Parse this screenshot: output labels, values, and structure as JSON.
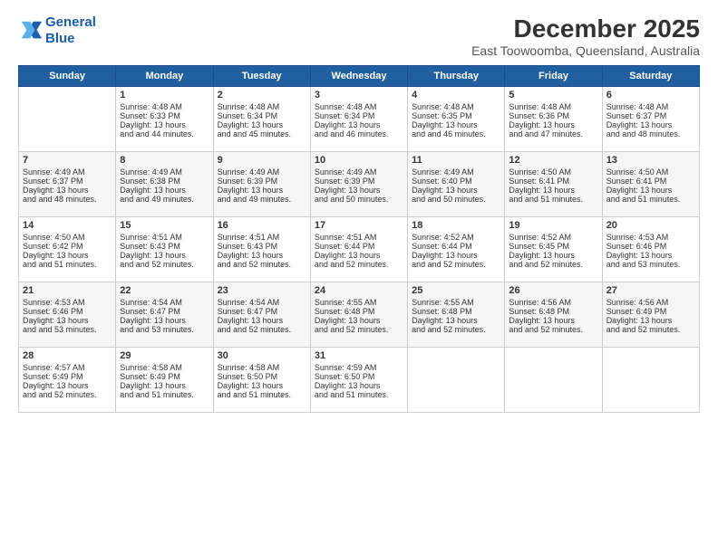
{
  "logo": {
    "line1": "General",
    "line2": "Blue"
  },
  "title": "December 2025",
  "subtitle": "East Toowoomba, Queensland, Australia",
  "days": [
    "Sunday",
    "Monday",
    "Tuesday",
    "Wednesday",
    "Thursday",
    "Friday",
    "Saturday"
  ],
  "weeks": [
    [
      {
        "date": "",
        "sunrise": "",
        "sunset": "",
        "daylight": ""
      },
      {
        "date": "1",
        "sunrise": "Sunrise: 4:48 AM",
        "sunset": "Sunset: 6:33 PM",
        "daylight": "Daylight: 13 hours and 44 minutes."
      },
      {
        "date": "2",
        "sunrise": "Sunrise: 4:48 AM",
        "sunset": "Sunset: 6:34 PM",
        "daylight": "Daylight: 13 hours and 45 minutes."
      },
      {
        "date": "3",
        "sunrise": "Sunrise: 4:48 AM",
        "sunset": "Sunset: 6:34 PM",
        "daylight": "Daylight: 13 hours and 46 minutes."
      },
      {
        "date": "4",
        "sunrise": "Sunrise: 4:48 AM",
        "sunset": "Sunset: 6:35 PM",
        "daylight": "Daylight: 13 hours and 46 minutes."
      },
      {
        "date": "5",
        "sunrise": "Sunrise: 4:48 AM",
        "sunset": "Sunset: 6:36 PM",
        "daylight": "Daylight: 13 hours and 47 minutes."
      },
      {
        "date": "6",
        "sunrise": "Sunrise: 4:48 AM",
        "sunset": "Sunset: 6:37 PM",
        "daylight": "Daylight: 13 hours and 48 minutes."
      }
    ],
    [
      {
        "date": "7",
        "sunrise": "Sunrise: 4:49 AM",
        "sunset": "Sunset: 6:37 PM",
        "daylight": "Daylight: 13 hours and 48 minutes."
      },
      {
        "date": "8",
        "sunrise": "Sunrise: 4:49 AM",
        "sunset": "Sunset: 6:38 PM",
        "daylight": "Daylight: 13 hours and 49 minutes."
      },
      {
        "date": "9",
        "sunrise": "Sunrise: 4:49 AM",
        "sunset": "Sunset: 6:39 PM",
        "daylight": "Daylight: 13 hours and 49 minutes."
      },
      {
        "date": "10",
        "sunrise": "Sunrise: 4:49 AM",
        "sunset": "Sunset: 6:39 PM",
        "daylight": "Daylight: 13 hours and 50 minutes."
      },
      {
        "date": "11",
        "sunrise": "Sunrise: 4:49 AM",
        "sunset": "Sunset: 6:40 PM",
        "daylight": "Daylight: 13 hours and 50 minutes."
      },
      {
        "date": "12",
        "sunrise": "Sunrise: 4:50 AM",
        "sunset": "Sunset: 6:41 PM",
        "daylight": "Daylight: 13 hours and 51 minutes."
      },
      {
        "date": "13",
        "sunrise": "Sunrise: 4:50 AM",
        "sunset": "Sunset: 6:41 PM",
        "daylight": "Daylight: 13 hours and 51 minutes."
      }
    ],
    [
      {
        "date": "14",
        "sunrise": "Sunrise: 4:50 AM",
        "sunset": "Sunset: 6:42 PM",
        "daylight": "Daylight: 13 hours and 51 minutes."
      },
      {
        "date": "15",
        "sunrise": "Sunrise: 4:51 AM",
        "sunset": "Sunset: 6:43 PM",
        "daylight": "Daylight: 13 hours and 52 minutes."
      },
      {
        "date": "16",
        "sunrise": "Sunrise: 4:51 AM",
        "sunset": "Sunset: 6:43 PM",
        "daylight": "Daylight: 13 hours and 52 minutes."
      },
      {
        "date": "17",
        "sunrise": "Sunrise: 4:51 AM",
        "sunset": "Sunset: 6:44 PM",
        "daylight": "Daylight: 13 hours and 52 minutes."
      },
      {
        "date": "18",
        "sunrise": "Sunrise: 4:52 AM",
        "sunset": "Sunset: 6:44 PM",
        "daylight": "Daylight: 13 hours and 52 minutes."
      },
      {
        "date": "19",
        "sunrise": "Sunrise: 4:52 AM",
        "sunset": "Sunset: 6:45 PM",
        "daylight": "Daylight: 13 hours and 52 minutes."
      },
      {
        "date": "20",
        "sunrise": "Sunrise: 4:53 AM",
        "sunset": "Sunset: 6:46 PM",
        "daylight": "Daylight: 13 hours and 53 minutes."
      }
    ],
    [
      {
        "date": "21",
        "sunrise": "Sunrise: 4:53 AM",
        "sunset": "Sunset: 6:46 PM",
        "daylight": "Daylight: 13 hours and 53 minutes."
      },
      {
        "date": "22",
        "sunrise": "Sunrise: 4:54 AM",
        "sunset": "Sunset: 6:47 PM",
        "daylight": "Daylight: 13 hours and 53 minutes."
      },
      {
        "date": "23",
        "sunrise": "Sunrise: 4:54 AM",
        "sunset": "Sunset: 6:47 PM",
        "daylight": "Daylight: 13 hours and 52 minutes."
      },
      {
        "date": "24",
        "sunrise": "Sunrise: 4:55 AM",
        "sunset": "Sunset: 6:48 PM",
        "daylight": "Daylight: 13 hours and 52 minutes."
      },
      {
        "date": "25",
        "sunrise": "Sunrise: 4:55 AM",
        "sunset": "Sunset: 6:48 PM",
        "daylight": "Daylight: 13 hours and 52 minutes."
      },
      {
        "date": "26",
        "sunrise": "Sunrise: 4:56 AM",
        "sunset": "Sunset: 6:48 PM",
        "daylight": "Daylight: 13 hours and 52 minutes."
      },
      {
        "date": "27",
        "sunrise": "Sunrise: 4:56 AM",
        "sunset": "Sunset: 6:49 PM",
        "daylight": "Daylight: 13 hours and 52 minutes."
      }
    ],
    [
      {
        "date": "28",
        "sunrise": "Sunrise: 4:57 AM",
        "sunset": "Sunset: 6:49 PM",
        "daylight": "Daylight: 13 hours and 52 minutes."
      },
      {
        "date": "29",
        "sunrise": "Sunrise: 4:58 AM",
        "sunset": "Sunset: 6:49 PM",
        "daylight": "Daylight: 13 hours and 51 minutes."
      },
      {
        "date": "30",
        "sunrise": "Sunrise: 4:58 AM",
        "sunset": "Sunset: 6:50 PM",
        "daylight": "Daylight: 13 hours and 51 minutes."
      },
      {
        "date": "31",
        "sunrise": "Sunrise: 4:59 AM",
        "sunset": "Sunset: 6:50 PM",
        "daylight": "Daylight: 13 hours and 51 minutes."
      },
      {
        "date": "",
        "sunrise": "",
        "sunset": "",
        "daylight": ""
      },
      {
        "date": "",
        "sunrise": "",
        "sunset": "",
        "daylight": ""
      },
      {
        "date": "",
        "sunrise": "",
        "sunset": "",
        "daylight": ""
      }
    ]
  ]
}
